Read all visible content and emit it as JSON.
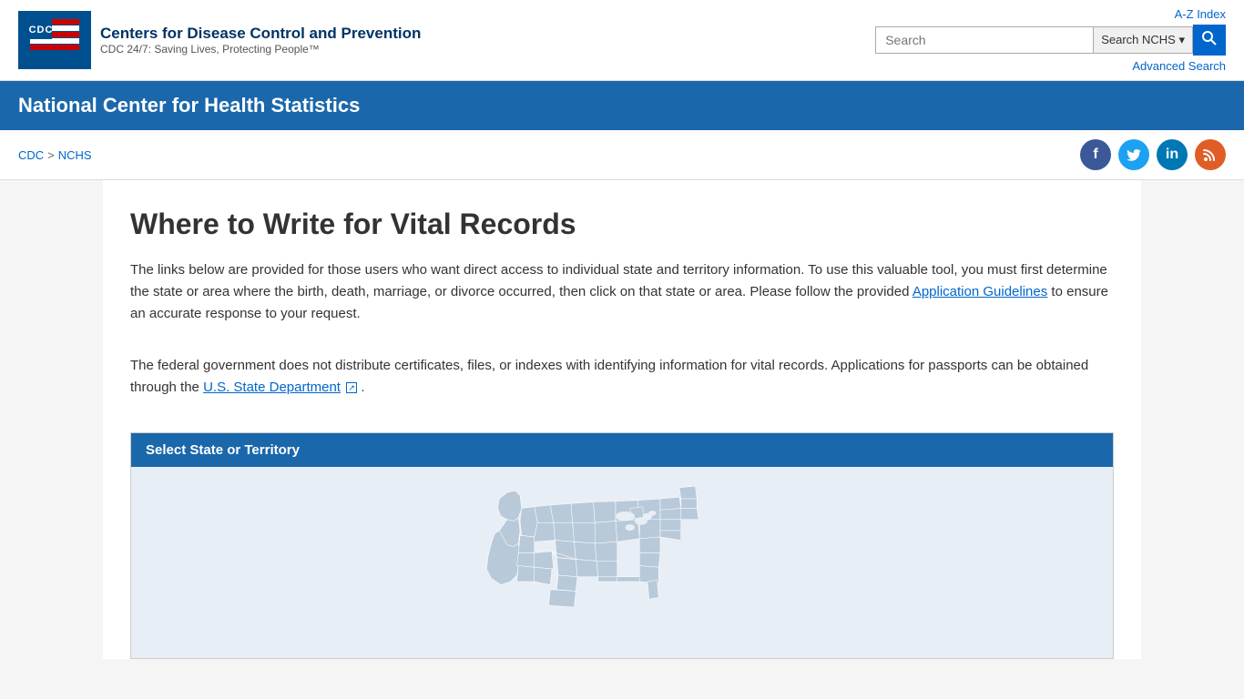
{
  "header": {
    "cdc_logo": "CDC",
    "org_name": "Centers for Disease Control and Prevention",
    "org_tagline": "CDC 24/7: Saving Lives, Protecting People™",
    "az_index": "A-Z Index",
    "search_placeholder": "Search",
    "search_dropdown_label": "Search NCHS",
    "search_btn_label": "🔍",
    "advanced_search": "Advanced Search"
  },
  "nav_banner": {
    "title": "National Center for Health Statistics"
  },
  "breadcrumb": {
    "cdc": "CDC",
    "separator": ">",
    "nchs": "NCHS"
  },
  "social": {
    "facebook": "f",
    "twitter": "t",
    "linkedin": "in",
    "rss": "rss"
  },
  "page": {
    "title": "Where to Write for Vital Records",
    "intro1": "The links below are provided for those users who want direct access to individual state and territory information. To use this valuable tool, you must first determine the state or area where the birth, death, marriage, or divorce occurred, then click on that state or area. Please follow the provided",
    "app_guidelines_link": "Application Guidelines",
    "intro1_end": "to ensure an accurate response to your request.",
    "intro2_start": "The federal government does not distribute certificates, files, or indexes with identifying information for vital records. Applications for passports can be obtained through the",
    "state_dept_link": "U.S. State Department",
    "intro2_end": ".",
    "select_state_header": "Select State or Territory"
  }
}
